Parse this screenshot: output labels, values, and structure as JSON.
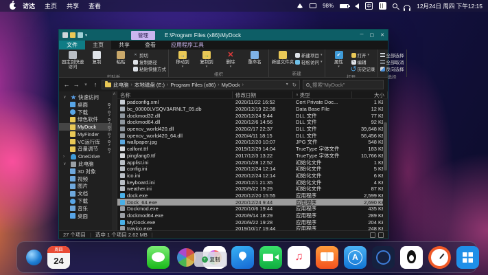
{
  "colors": {
    "titlebar": "#0d5e66",
    "tab_file": "#0f7c85",
    "manage_chip": "#c9b5f0",
    "selection_row": "#9c9c9c",
    "folder_yellow": "#e9c856"
  },
  "menu_bar": {
    "menus": [
      "访达",
      "主页",
      "共享",
      "查看"
    ],
    "battery_pct": "98%",
    "input_method": "中",
    "datetime": "12月24日 周四 下午12:15"
  },
  "window": {
    "manage_tab": "管理",
    "title": "E:\\Program Files (x86)\\MyDock",
    "tabs": [
      {
        "label": "文件",
        "style": "file"
      },
      {
        "label": "主页",
        "style": "active"
      },
      {
        "label": "共享",
        "style": ""
      },
      {
        "label": "查看",
        "style": ""
      },
      {
        "label": "应用程序工具",
        "style": "tools"
      }
    ],
    "ribbon_groups": [
      {
        "label": "剪贴板",
        "big": [
          {
            "label": "固定到快速访问",
            "icon": "pin"
          },
          {
            "label": "复制",
            "icon": "copy"
          },
          {
            "label": "粘贴",
            "icon": "paste"
          }
        ],
        "small": [
          {
            "label": "剪切",
            "icon": "cut"
          },
          {
            "label": "复制路径",
            "icon": "path"
          },
          {
            "label": "粘贴快捷方式",
            "icon": "shortcut"
          }
        ]
      },
      {
        "label": "组织",
        "big": [
          {
            "label": "移动到",
            "icon": "move",
            "dd": true
          },
          {
            "label": "复制到",
            "icon": "copyto",
            "dd": true
          },
          {
            "label": "删除",
            "icon": "delete",
            "dd": true
          },
          {
            "label": "重命名",
            "icon": "rename"
          }
        ],
        "small": []
      },
      {
        "label": "新建",
        "big": [
          {
            "label": "新建文件夹",
            "icon": "newfolder"
          }
        ],
        "small": [
          {
            "label": "新建项目",
            "icon": "newitem",
            "dd": true
          },
          {
            "label": "轻松访问",
            "icon": "easy",
            "dd": true
          }
        ]
      },
      {
        "label": "打开",
        "big": [
          {
            "label": "属性",
            "icon": "props",
            "dd": true
          }
        ],
        "small": [
          {
            "label": "打开",
            "icon": "open",
            "dd": true
          },
          {
            "label": "编辑",
            "icon": "edit"
          },
          {
            "label": "历史记录",
            "icon": "history"
          }
        ]
      },
      {
        "label": "选择",
        "big": [],
        "small": [
          {
            "label": "全部选择",
            "icon": "selall"
          },
          {
            "label": "全部取消",
            "icon": "selnone"
          },
          {
            "label": "反向选择",
            "icon": "selinv"
          }
        ]
      }
    ],
    "breadcrumb": [
      "此电脑",
      "本地磁盘 (E:)",
      "Program Files (x86)",
      "MyDock"
    ],
    "search_placeholder": "搜索\"MyDock\"",
    "columns": [
      "名称",
      "修改日期",
      "类型",
      "大小"
    ],
    "sort_column": "类型",
    "files": [
      {
        "name": "padconfig.xml",
        "date": "2020/11/22 16:52",
        "type": "Cert Private Doc...",
        "size": "1 KB",
        "kind": "xml",
        "selected": false
      },
      {
        "name": "bc_00000LVSQV3ARNLT_05.db",
        "date": "2020/12/19 22:38",
        "type": "Data Base File",
        "size": "12 KB",
        "kind": "db",
        "selected": false
      },
      {
        "name": "dockmod32.dll",
        "date": "2020/12/24 9:44",
        "type": "DLL 文件",
        "size": "77 KB",
        "kind": "dll",
        "selected": false
      },
      {
        "name": "dockmod64.dll",
        "date": "2020/12/6 14:56",
        "type": "DLL 文件",
        "size": "92 KB",
        "kind": "dll",
        "selected": false
      },
      {
        "name": "opencv_world420.dll",
        "date": "2020/2/17 22:37",
        "type": "DLL 文件",
        "size": "39,648 KB",
        "kind": "dll",
        "selected": false
      },
      {
        "name": "opencv_world420_64.dll",
        "date": "2020/4/11 18:15",
        "type": "DLL 文件",
        "size": "56,456 KB",
        "kind": "dll",
        "selected": false
      },
      {
        "name": "wallpaper.jpg",
        "date": "2020/12/20 10:07",
        "type": "JPG 文件",
        "size": "548 KB",
        "kind": "jpg",
        "selected": false
      },
      {
        "name": "calfont.ttf",
        "date": "2019/12/29 14:04",
        "type": "TrueType 字体文件",
        "size": "183 KB",
        "kind": "ttf",
        "selected": false
      },
      {
        "name": "pingfang0.ttf",
        "date": "2017/12/3 13:22",
        "type": "TrueType 字体文件",
        "size": "10,766 KB",
        "kind": "ttf",
        "selected": false
      },
      {
        "name": "applist.ini",
        "date": "2020/1/28 12:52",
        "type": "初始化文件",
        "size": "1 KB",
        "kind": "ini",
        "selected": false
      },
      {
        "name": "config.ini",
        "date": "2020/12/24 12:14",
        "type": "初始化文件",
        "size": "5 KB",
        "kind": "ini",
        "selected": false
      },
      {
        "name": "ico.ini",
        "date": "2020/12/24 12:14",
        "type": "初始化文件",
        "size": "6 KB",
        "kind": "ini",
        "selected": false
      },
      {
        "name": "keyboard.ini",
        "date": "2020/12/1 21:35",
        "type": "初始化文件",
        "size": "4 KB",
        "kind": "ini",
        "selected": false
      },
      {
        "name": "weather.ini",
        "date": "2020/9/22 19:29",
        "type": "初始化文件",
        "size": "87 KB",
        "kind": "ini",
        "selected": false
      },
      {
        "name": "dock.exe",
        "date": "2020/12/20 15:55",
        "type": "应用程序",
        "size": "2,599 KB",
        "kind": "exe",
        "selected": false
      },
      {
        "name": "Dock_64.exe",
        "date": "2020/12/24 9:44",
        "type": "应用程序",
        "size": "2,690 KB",
        "kind": "exe",
        "selected": true
      },
      {
        "name": "Dockmod.exe",
        "date": "2020/10/6 19:44",
        "type": "应用程序",
        "size": "435 KB",
        "kind": "exe2",
        "selected": false
      },
      {
        "name": "dockmod64.exe",
        "date": "2020/9/14 18:29",
        "type": "应用程序",
        "size": "289 KB",
        "kind": "exe2",
        "selected": false
      },
      {
        "name": "MyDock.exe",
        "date": "2020/9/22 19:28",
        "type": "应用程序",
        "size": "204 KB",
        "kind": "exe",
        "selected": false
      },
      {
        "name": "trayico.exe",
        "date": "2019/10/17 19:44",
        "type": "应用程序",
        "size": "248 KB",
        "kind": "exe2",
        "selected": false
      }
    ],
    "status_items": "27 个项目",
    "status_selected": "选中 1 个项目 2.62 MB"
  },
  "sidebar": {
    "sections": [
      {
        "label": "快速访问",
        "icon": "star",
        "expanded": true,
        "items": [
          {
            "label": "桌面",
            "icon": "desktop",
            "pinned": true
          },
          {
            "label": "下载",
            "icon": "download",
            "pinned": true
          },
          {
            "label": "绿色软件",
            "icon": "folder",
            "pinned": true
          },
          {
            "label": "MyDock",
            "icon": "folder",
            "pinned": true,
            "selected": true
          },
          {
            "label": "MyFinder",
            "icon": "folder",
            "pinned": true
          },
          {
            "label": "VC运行库",
            "icon": "folder",
            "pinned": true
          },
          {
            "label": "音量调节",
            "icon": "folder",
            "pinned": true
          }
        ]
      },
      {
        "label": "OneDrive",
        "icon": "cloud",
        "expanded": false,
        "items": []
      },
      {
        "label": "此电脑",
        "icon": "pc",
        "expanded": true,
        "items": [
          {
            "label": "3D 对象",
            "icon": "box"
          },
          {
            "label": "视频",
            "icon": "video"
          },
          {
            "label": "图片",
            "icon": "picture"
          },
          {
            "label": "文档",
            "icon": "doc"
          },
          {
            "label": "下载",
            "icon": "download"
          },
          {
            "label": "音乐",
            "icon": "music"
          },
          {
            "label": "桌面",
            "icon": "desktop"
          }
        ]
      }
    ]
  },
  "dock": {
    "icons": [
      "launcher",
      "calendar",
      "messages",
      "photos",
      "maps-white",
      "baidu-maps",
      "facetime",
      "music",
      "books",
      "app-store",
      "compass",
      "qq",
      "clock",
      "windows"
    ],
    "calendar": {
      "weekday": "周四",
      "day": "24",
      "month": "12"
    },
    "drag_label": "复制",
    "music_glyph": "♫"
  }
}
